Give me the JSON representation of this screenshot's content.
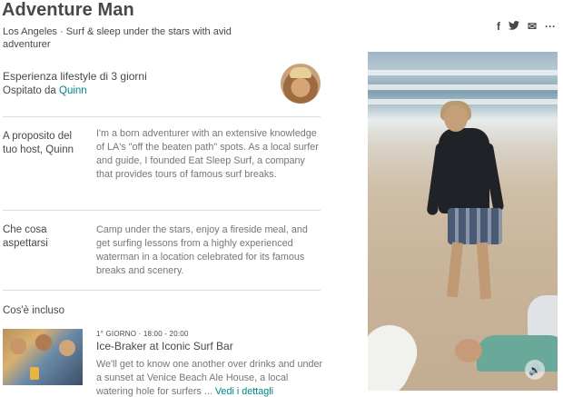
{
  "header": {
    "title": "Adventure Man",
    "subtitle": "Los Angeles · Surf & sleep under the stars with avid adventurer"
  },
  "share": {
    "facebook": "f",
    "twitter": "🐦",
    "email": "✉",
    "more": "···"
  },
  "experience": {
    "title": "Esperienza lifestyle di 3 giorni",
    "host_prefix": "Ospitato da ",
    "host_name": "Quinn"
  },
  "sections": [
    {
      "label": "A proposito del tuo host, Quinn",
      "text": "I'm a born adventurer with an extensive knowledge of LA's \"off the beaten path\" spots. As a local surfer and guide, I founded Eat Sleep Surf, a company that provides tours of famous surf breaks."
    },
    {
      "label": "Che cosa aspettarsi",
      "text": "Camp under the stars, enjoy a fireside meal, and get surfing lessons from a highly experienced waterman in a location celebrated for its famous breaks and scenery."
    }
  ],
  "included": {
    "title": "Cos'è incluso",
    "items": [
      {
        "meta": "1° GIORNO · 18:00 - 20:00",
        "name": "Ice-Braker at Iconic Surf Bar",
        "desc": "We'll get to know one another over drinks and under a sunset at Venice Beach Ale House, a local watering hole for surfers ... ",
        "link": "Vedi i dettagli"
      }
    ]
  },
  "media": {
    "sound_icon": "🔊"
  },
  "colors": {
    "link": "#008489",
    "text": "#484848",
    "muted": "#767676"
  }
}
